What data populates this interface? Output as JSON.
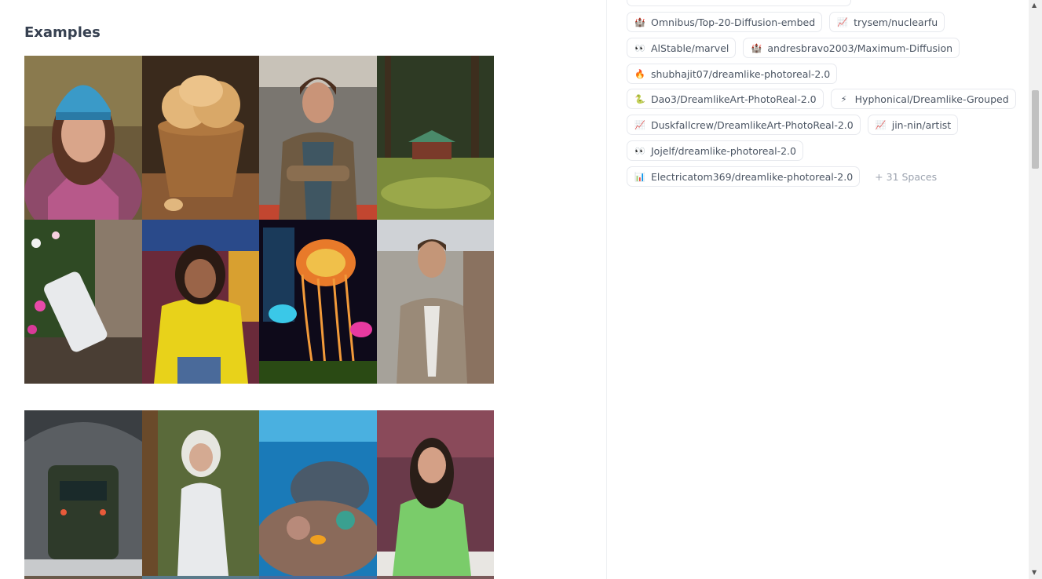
{
  "examples": {
    "title": "Examples",
    "grid1": [
      {
        "name": "example-woman-beanie"
      },
      {
        "name": "example-bread-basket"
      },
      {
        "name": "example-man-crossed-arms"
      },
      {
        "name": "example-cabin-forest"
      },
      {
        "name": "example-phone-flowers"
      },
      {
        "name": "example-woman-yellow-hoodie"
      },
      {
        "name": "example-neon-jellyfish"
      },
      {
        "name": "example-man-suit-ruins"
      }
    ],
    "grid2": [
      {
        "name": "example-train-tunnel"
      },
      {
        "name": "example-woman-white-suit"
      },
      {
        "name": "example-coral-reef"
      },
      {
        "name": "example-woman-green-top"
      }
    ]
  },
  "spaces": {
    "rows": [
      [
        {
          "icon": "🏰",
          "label": "Omnibus/Top-20-Diffusion-embed"
        },
        {
          "icon": "📈",
          "label": "trysem/nuclearfu"
        }
      ],
      [
        {
          "icon": "👀",
          "label": "AlStable/marvel"
        },
        {
          "icon": "🏰",
          "label": "andresbravo2003/Maximum-Diffusion"
        }
      ],
      [
        {
          "icon": "🔥",
          "label": "shubhajit07/dreamlike-photoreal-2.0"
        }
      ],
      [
        {
          "icon": "🐍",
          "label": "Dao3/DreamlikeArt-PhotoReal-2.0"
        },
        {
          "icon": "⚡",
          "label": "Hyphonical/Dreamlike-Grouped"
        }
      ],
      [
        {
          "icon": "📈",
          "label": "Duskfallcrew/DreamlikeArt-PhotoReal-2.0"
        },
        {
          "icon": "📈",
          "label": "jin-nin/artist"
        }
      ],
      [
        {
          "icon": "👀",
          "label": "Jojelf/dreamlike-photoreal-2.0"
        }
      ],
      [
        {
          "icon": "📊",
          "label": "Electricatom369/dreamlike-photoreal-2.0"
        }
      ]
    ],
    "more_label": "+ 31 Spaces"
  }
}
